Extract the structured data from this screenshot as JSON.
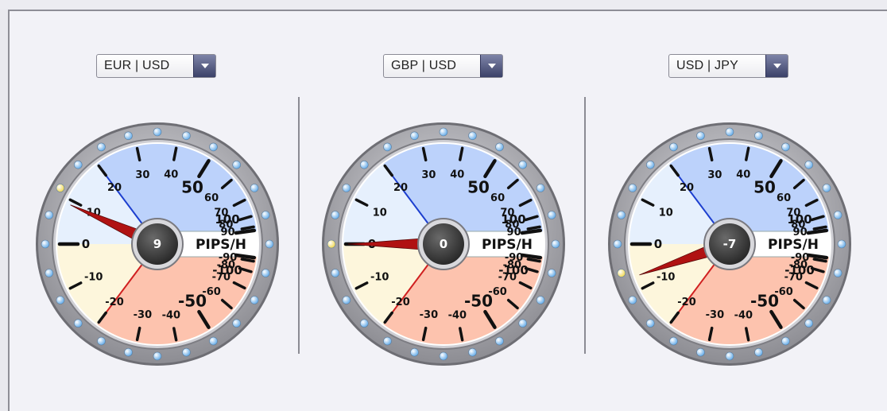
{
  "gauges": [
    {
      "pair": "EUR | USD",
      "value": 9,
      "value_label": "9",
      "unit": "PIPS/H"
    },
    {
      "pair": "GBP | USD",
      "value": 0,
      "value_label": "0",
      "unit": "PIPS/H"
    },
    {
      "pair": "USD | JPY",
      "value": -7,
      "value_label": "-7",
      "unit": "PIPS/H"
    }
  ],
  "scale": {
    "upper": [
      "10",
      "20",
      "30",
      "40",
      "50",
      "60",
      "70",
      "80",
      "90",
      "100"
    ],
    "lower": [
      "-10",
      "-20",
      "-30",
      "-40",
      "-50",
      "-60",
      "-70",
      "-80",
      "-90",
      "-100"
    ],
    "zero": "0"
  },
  "colors": {
    "positive_band": "#bcd2fb",
    "positive_inner": "#e6f0fd",
    "negative_band": "#fdc3ae",
    "negative_inner": "#fdf6dc",
    "needle": "#b01212",
    "plus20_marker": "#1d3fcf",
    "minus20_marker": "#d02020",
    "bezel": "#a6a6aa",
    "hub": "#3a3a3a"
  }
}
